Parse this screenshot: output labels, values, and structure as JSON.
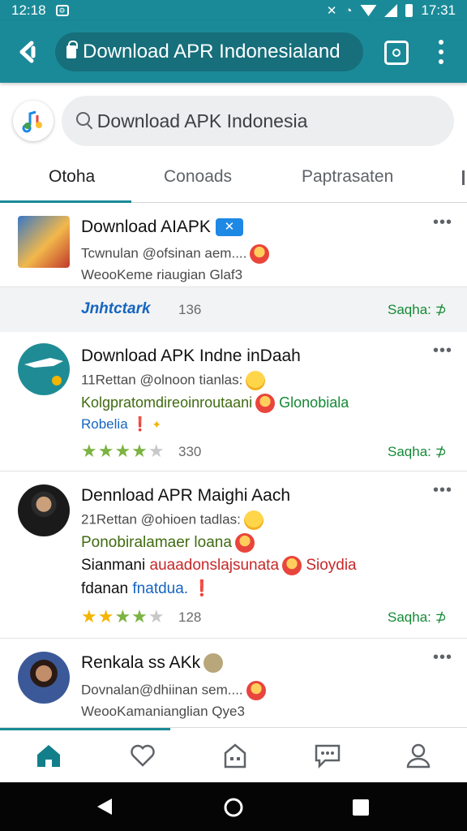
{
  "status_bar": {
    "left_time": "12:18",
    "right_time": "17:31"
  },
  "browser": {
    "url": "Download APR Indonesialand"
  },
  "search": {
    "query": "Download APK Indonesia"
  },
  "tabs": [
    {
      "label": "Otoha",
      "active": true
    },
    {
      "label": "Conoads",
      "active": false
    },
    {
      "label": "Paptrasaten",
      "active": false
    }
  ],
  "feed": {
    "cards": [
      {
        "title": "Download AIAPK",
        "line1": "Tcwnulan @ofsinan aem....",
        "line2": "WeooKeme riaugian Glaf3",
        "footer_left": "Jnhtctark",
        "footer_count": "136",
        "footer_right": "Saqha: ⊅"
      },
      {
        "title": "Download APK Indne inDaah",
        "line1": "11Rettan @olnoon tianlas:",
        "line2_a": "Kolgpratomdireoinroutaani",
        "line2_b": "Glonobiala",
        "line3": "Robelia",
        "rating": 4,
        "count": "330",
        "status": "Saqha: ⊅"
      },
      {
        "title": "Dennload APR Maighi Aach",
        "line1": "21Rettan @ohioen tadlas:",
        "line2": "Ponobiralamaer loana",
        "line3_a": "Sianmani",
        "line3_b": "auaadonslajsunata",
        "line3_c": "Sioydia",
        "line4_a": "fdanan",
        "line4_b": "fnatdua.",
        "rating": 4,
        "count": "128",
        "status": "Saqha: ⊅"
      },
      {
        "title": "Renkala ss AKk",
        "line1": "Dovnalan@dhiinan sem....",
        "line2": "WeooKamanianglian Qye3"
      }
    ]
  },
  "bottom_nav": [
    "home-icon",
    "heart-icon",
    "apps-icon",
    "chat-icon",
    "profile-icon"
  ],
  "colors": {
    "primary": "#1b8a98",
    "green": "#138a36",
    "blue": "#1565c0"
  }
}
